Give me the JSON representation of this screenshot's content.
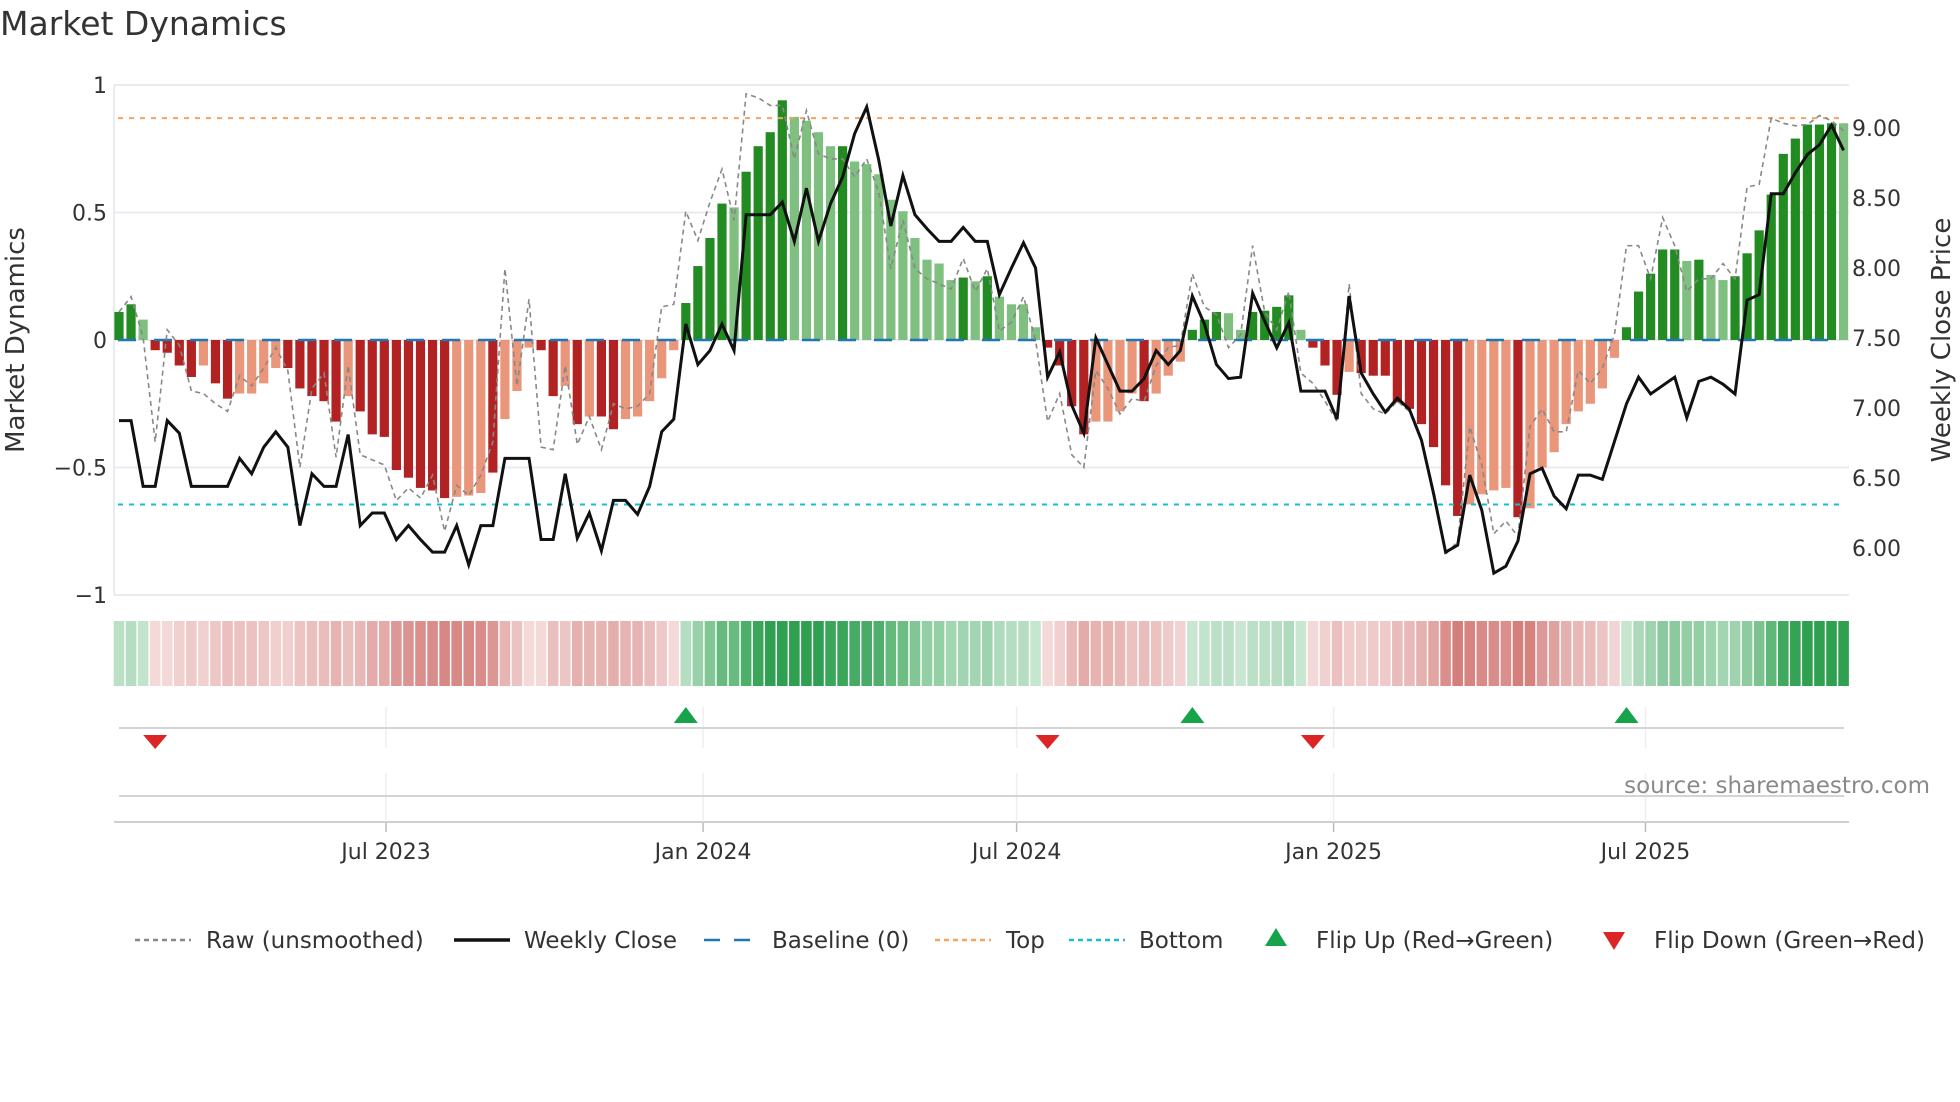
{
  "title": "Market Dynamics",
  "source": "source: sharemaestro.com",
  "colors": {
    "strong_up": "#228b22",
    "weak_up": "#7fbf7f",
    "strong_down": "#b22222",
    "weak_down": "#e9967a",
    "raw": "#888888",
    "close": "#111111",
    "baseline": "#1f77b4",
    "top": "#f4a460",
    "bottom": "#17becf",
    "flip_up": "#16a34a",
    "flip_down": "#dc2626"
  },
  "legend": [
    {
      "key": "raw",
      "label": "Raw (unsmoothed)",
      "style": "dotted"
    },
    {
      "key": "close",
      "label": "Weekly Close",
      "style": "solid"
    },
    {
      "key": "baseline",
      "label": "Baseline (0)",
      "style": "dashed"
    },
    {
      "key": "top",
      "label": "Top",
      "style": "dotted"
    },
    {
      "key": "bottom",
      "label": "Bottom",
      "style": "dotted"
    },
    {
      "key": "flip_up",
      "label": "Flip Up (Red→Green)",
      "style": "triangle-up"
    },
    {
      "key": "flip_down",
      "label": "Flip Down (Green→Red)",
      "style": "triangle-down"
    }
  ],
  "chart_data": {
    "type": "bar",
    "title": "Market Dynamics",
    "ylabel": "Market Dynamics",
    "y2label": "Weekly Close Price",
    "ylim": [
      -1,
      1
    ],
    "y2lim": [
      5.664,
      9.307
    ],
    "yticks": [
      {
        "v": 1,
        "label": "1"
      },
      {
        "v": 0.5,
        "label": "0.5"
      },
      {
        "v": 0,
        "label": "0"
      },
      {
        "v": -0.5,
        "label": "−0.5"
      },
      {
        "v": -1,
        "label": "−1"
      }
    ],
    "y2ticks": [
      {
        "v": 9.0,
        "label": "9.00"
      },
      {
        "v": 8.5,
        "label": "8.50"
      },
      {
        "v": 8.0,
        "label": "8.00"
      },
      {
        "v": 7.5,
        "label": "7.50"
      },
      {
        "v": 7.0,
        "label": "7.00"
      },
      {
        "v": 6.5,
        "label": "6.50"
      },
      {
        "v": 6.0,
        "label": "6.00"
      }
    ],
    "xticks": [
      {
        "date": "2023-07-01",
        "label": "Jul 2023"
      },
      {
        "date": "2024-01-01",
        "label": "Jan 2024"
      },
      {
        "date": "2024-07-01",
        "label": "Jul 2024"
      },
      {
        "date": "2025-01-01",
        "label": "Jan 2025"
      },
      {
        "date": "2025-07-01",
        "label": "Jul 2025"
      }
    ],
    "start_date": "2023-01-27",
    "end_date": "2025-10-24",
    "frequency": "weekly",
    "top": 0.87,
    "bottom": -0.645,
    "baseline": 0,
    "values": [
      0.11,
      0.14,
      0.08,
      -0.04,
      -0.05,
      -0.1,
      -0.145,
      -0.1,
      -0.17,
      -0.23,
      -0.21,
      -0.21,
      -0.17,
      -0.11,
      -0.11,
      -0.19,
      -0.22,
      -0.24,
      -0.32,
      -0.22,
      -0.28,
      -0.37,
      -0.38,
      -0.51,
      -0.54,
      -0.58,
      -0.59,
      -0.62,
      -0.615,
      -0.61,
      -0.6,
      -0.52,
      -0.31,
      -0.2,
      -0.03,
      -0.04,
      -0.22,
      -0.18,
      -0.33,
      -0.3,
      -0.3,
      -0.35,
      -0.31,
      -0.3,
      -0.24,
      -0.15,
      -0.04,
      0.145,
      0.29,
      0.4,
      0.535,
      0.52,
      0.66,
      0.76,
      0.815,
      0.94,
      0.875,
      0.86,
      0.815,
      0.76,
      0.76,
      0.7,
      0.69,
      0.65,
      0.55,
      0.505,
      0.4,
      0.315,
      0.3,
      0.235,
      0.245,
      0.23,
      0.25,
      0.17,
      0.14,
      0.14,
      0.05,
      -0.03,
      -0.1,
      -0.26,
      -0.37,
      -0.32,
      -0.32,
      -0.28,
      -0.21,
      -0.24,
      -0.21,
      -0.14,
      -0.085,
      0.04,
      0.08,
      0.11,
      0.105,
      0.04,
      0.11,
      0.115,
      0.13,
      0.175,
      0.04,
      -0.03,
      -0.1,
      -0.215,
      -0.125,
      -0.13,
      -0.14,
      -0.14,
      -0.245,
      -0.27,
      -0.33,
      -0.42,
      -0.57,
      -0.69,
      -0.645,
      -0.605,
      -0.59,
      -0.58,
      -0.695,
      -0.66,
      -0.5,
      -0.44,
      -0.33,
      -0.28,
      -0.25,
      -0.19,
      -0.07,
      0.05,
      0.19,
      0.26,
      0.355,
      0.355,
      0.31,
      0.315,
      0.255,
      0.235,
      0.25,
      0.34,
      0.43,
      0.57,
      0.73,
      0.79,
      0.845,
      0.845,
      0.85,
      0.85
    ],
    "strength": "SSWSSSSWSSWWWWSSSSSWSSSSSSSSWWWSWWWSSWSWSSWWWWWSSSSWSSSSWWWWSWWWWWWWWWSWSWWWWSSSSWWWWSWWWSSSWWSSSSWSSSWSSSSSSSSSWWWWSWWWWWWWWSSSSSWSWWSSSSSSSSSW",
    "raw": [
      0.11,
      0.17,
      0.01,
      -0.4,
      0.04,
      -0.02,
      -0.2,
      -0.21,
      -0.25,
      -0.28,
      -0.14,
      -0.18,
      -0.11,
      -0.03,
      -0.12,
      -0.5,
      -0.19,
      -0.13,
      -0.46,
      -0.1,
      -0.45,
      -0.47,
      -0.49,
      -0.63,
      -0.58,
      -0.62,
      -0.53,
      -0.75,
      -0.57,
      -0.61,
      -0.53,
      -0.4,
      0.28,
      -0.18,
      0.16,
      -0.42,
      -0.43,
      -0.1,
      -0.41,
      -0.3,
      -0.43,
      -0.25,
      -0.27,
      -0.26,
      -0.21,
      0.13,
      0.14,
      0.505,
      0.39,
      0.54,
      0.67,
      0.47,
      0.965,
      0.95,
      0.92,
      0.92,
      0.71,
      0.9,
      0.73,
      0.71,
      0.71,
      0.64,
      0.71,
      0.58,
      0.28,
      0.47,
      0.28,
      0.24,
      0.22,
      0.2,
      0.32,
      0.19,
      0.28,
      0.035,
      0.07,
      0.17,
      0.0,
      -0.32,
      -0.21,
      -0.45,
      -0.5,
      -0.12,
      -0.19,
      -0.29,
      -0.23,
      -0.24,
      -0.1,
      -0.03,
      -0.02,
      0.26,
      0.13,
      0.1,
      -0.03,
      0.02,
      0.37,
      0.11,
      0.04,
      0.19,
      -0.13,
      -0.17,
      -0.24,
      -0.32,
      0.22,
      -0.21,
      -0.27,
      -0.29,
      -0.24,
      -0.28,
      -0.4,
      -0.59,
      -0.84,
      -0.79,
      -0.34,
      -0.49,
      -0.76,
      -0.71,
      -0.77,
      -0.34,
      -0.27,
      -0.36,
      -0.36,
      -0.12,
      -0.17,
      -0.11,
      0.02,
      0.37,
      0.37,
      0.24,
      0.48,
      0.37,
      0.19,
      0.24,
      0.24,
      0.3,
      0.24,
      0.6,
      0.61,
      0.87,
      0.85,
      0.84,
      0.845,
      0.88,
      0.86,
      0.82
    ],
    "close": [
      6.91,
      6.91,
      6.44,
      6.44,
      6.91,
      6.82,
      6.44,
      6.44,
      6.44,
      6.44,
      6.64,
      6.53,
      6.72,
      6.83,
      6.72,
      6.16,
      6.53,
      6.44,
      6.44,
      6.81,
      6.16,
      6.25,
      6.25,
      6.06,
      6.16,
      6.06,
      5.97,
      5.97,
      6.16,
      5.88,
      6.16,
      6.16,
      6.64,
      6.64,
      6.64,
      6.06,
      6.06,
      6.53,
      6.07,
      6.25,
      5.98,
      6.34,
      6.34,
      6.24,
      6.44,
      6.83,
      6.92,
      7.6,
      7.31,
      7.41,
      7.6,
      7.41,
      8.38,
      8.38,
      8.38,
      8.47,
      8.19,
      8.57,
      8.19,
      8.46,
      8.65,
      8.96,
      9.15,
      8.77,
      8.3,
      8.66,
      8.38,
      8.28,
      8.19,
      8.19,
      8.29,
      8.19,
      8.19,
      7.81,
      8.0,
      8.18,
      8.0,
      7.22,
      7.4,
      7.02,
      6.82,
      7.5,
      7.31,
      7.12,
      7.12,
      7.21,
      7.41,
      7.31,
      7.41,
      7.8,
      7.6,
      7.31,
      7.21,
      7.22,
      7.82,
      7.62,
      7.43,
      7.61,
      7.12,
      7.12,
      7.12,
      6.92,
      7.8,
      7.25,
      7.1,
      6.97,
      7.07,
      6.99,
      6.77,
      6.39,
      5.97,
      6.02,
      6.52,
      6.27,
      5.82,
      5.87,
      6.05,
      6.53,
      6.57,
      6.37,
      6.28,
      6.52,
      6.52,
      6.49,
      6.76,
      7.03,
      7.22,
      7.1,
      7.16,
      7.22,
      6.93,
      7.19,
      7.22,
      7.17,
      7.1,
      7.77,
      7.81,
      8.53,
      8.53,
      8.68,
      8.81,
      8.88,
      9.02,
      8.84
    ],
    "flips_up": [
      47,
      89,
      125
    ],
    "flips_down": [
      3,
      77,
      99
    ]
  }
}
